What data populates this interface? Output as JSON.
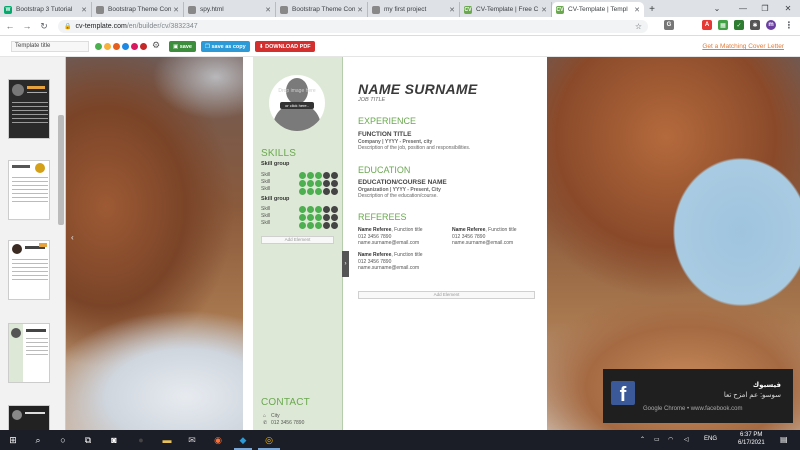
{
  "browser": {
    "tabs": [
      {
        "title": "Bootstrap 3 Tutorial",
        "icon": "w3schools-icon",
        "color": "#04aa6d",
        "glyph": "W",
        "active": false
      },
      {
        "title": "Bootstrap Theme Con",
        "icon": "globe-icon",
        "color": "#888",
        "glyph": "",
        "active": false
      },
      {
        "title": "spy.html",
        "icon": "globe-icon",
        "color": "#888",
        "glyph": "",
        "active": false
      },
      {
        "title": "Bootstrap Theme Con",
        "icon": "globe-icon",
        "color": "#888",
        "glyph": "",
        "active": false
      },
      {
        "title": "my first project",
        "icon": "globe-icon",
        "color": "#888",
        "glyph": "",
        "active": false
      },
      {
        "title": "CV-Template | Free C",
        "icon": "cv-template-icon",
        "color": "#6aa84f",
        "glyph": "CV",
        "active": false
      },
      {
        "title": "CV-Template | Templ",
        "icon": "cv-template-icon",
        "color": "#6aa84f",
        "glyph": "CV",
        "active": true
      }
    ],
    "url_host": "cv-template.com",
    "url_path": "/en/builder/cv/3832347"
  },
  "toolbar": {
    "title_placeholder": "Template title",
    "colors": [
      "#4caf50",
      "#f7b23b",
      "#e55f1f",
      "#1e88e5",
      "#d81b60",
      "#c62828"
    ],
    "save": "save",
    "save_copy": "save as copy",
    "download": "DOWNLOAD PDF",
    "cover_link": "Get a Matching Cover Letter"
  },
  "cv": {
    "avatar_drop": "Drop image here",
    "avatar_click": "or click here..",
    "skills_heading": "SKILLS",
    "skill_groups": [
      {
        "name": "Skill group",
        "skills": [
          "Skill",
          "Skill",
          "Skill"
        ]
      },
      {
        "name": "Skill group",
        "skills": [
          "Skill",
          "Skill",
          "Skill"
        ]
      }
    ],
    "skill_levels": [
      3,
      3,
      3,
      3,
      3,
      3
    ],
    "add_element": "Add Element",
    "contact_heading": "CONTACT",
    "contact": [
      "City",
      "012 3456 7890"
    ],
    "name": "NAME SURNAME",
    "job_title": "JOB TITLE",
    "experience_heading": "EXPERIENCE",
    "exp_title": "FUNCTION TITLE",
    "exp_sub": "Company | YYYY - Present, city",
    "exp_desc": "Description of the job, position and responsibilities.",
    "education_heading": "EDUCATION",
    "edu_title": "EDUCATION/COURSE NAME",
    "edu_sub": "Organization | YYYY - Present, City",
    "edu_desc": "Description of the education/course.",
    "referees_heading": "REFEREES",
    "referees": [
      {
        "name": "Name Referee",
        "role": ", Function title",
        "phone": "012 3456 7890",
        "email": "name.surname@email.com"
      },
      {
        "name": "Name Referee",
        "role": ", Function title",
        "phone": "012 3456 7890",
        "email": "name.surname@email.com"
      },
      {
        "name": "Name Referee",
        "role": ", Function title",
        "phone": "012 3456 7890",
        "email": "name.surname@email.com"
      }
    ]
  },
  "notification": {
    "app": "فيسبوك",
    "message": "سوسو: عم امزح تعا",
    "source": "Google Chrome • www.facebook.com"
  },
  "taskbar": {
    "lang": "ENG",
    "time": "6:37 PM",
    "date": "6/17/2021"
  }
}
